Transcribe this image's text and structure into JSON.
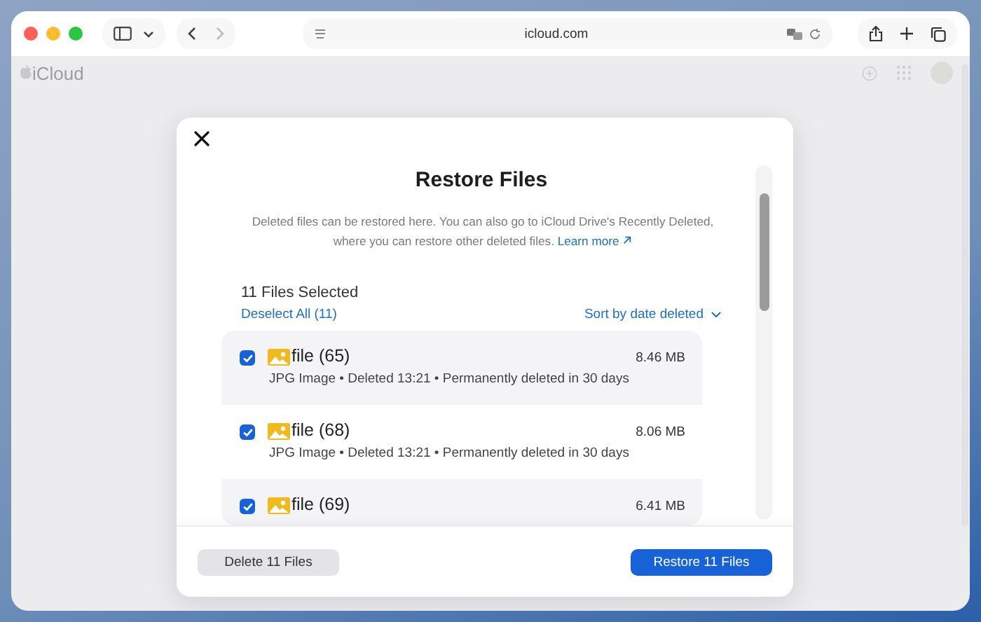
{
  "browser": {
    "url": "icloud.com"
  },
  "app": {
    "name": "iCloud"
  },
  "modal": {
    "title": "Restore Files",
    "description": "Deleted files can be restored here. You can also go to iCloud Drive's Recently Deleted, where you can restore other deleted files.",
    "learn_more": "Learn more",
    "selected_count": "11 Files Selected",
    "deselect": "Deselect All (11)",
    "sort": "Sort by date deleted",
    "files": [
      {
        "name": "file (65)",
        "meta": "JPG Image • Deleted 13:21 • Permanently deleted in 30 days",
        "size": "8.46 MB",
        "checked": true
      },
      {
        "name": "file (68)",
        "meta": "JPG Image • Deleted 13:21 • Permanently deleted in 30 days",
        "size": "8.06 MB",
        "checked": true
      },
      {
        "name": "file (69)",
        "size": "6.41 MB",
        "checked": true
      }
    ],
    "buttons": [
      {
        "label": "Delete 11 Files",
        "kind": "secondary"
      },
      {
        "label": "Restore 11 Files",
        "kind": "primary"
      }
    ]
  }
}
